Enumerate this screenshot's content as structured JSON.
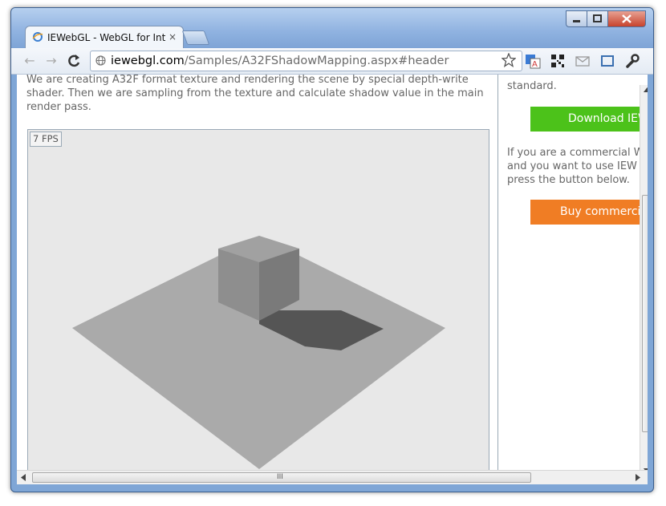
{
  "tab": {
    "title": "IEWebGL - WebGL for Interr",
    "close": "×"
  },
  "nav": {
    "back": "←",
    "forward": "→",
    "reload": "C"
  },
  "address": {
    "host": "iewebgl.com",
    "path": "/Samples/A32FShadowMapping.aspx#header"
  },
  "toolbar_icons": [
    "star-icon",
    "translate-icon",
    "qr-code-icon",
    "mail-icon",
    "fullscreen-icon",
    "wrench-icon"
  ],
  "page": {
    "intro": "We are creating A32F format texture and rendering the scene by special depth-write shader. Then we are sampling from the texture and calculate shadow value in the main render pass.",
    "fps": "7 FPS"
  },
  "sidebar": {
    "top_text": "standard.",
    "download_button": "Download IEWebGL",
    "commercial_lines": [
      "If you are a commercial W",
      "and you want to use IEW",
      "press the button below."
    ],
    "buy_button": "Buy commercial"
  },
  "scrollbar": {
    "grip": "III"
  },
  "colors": {
    "download_green": "#4cc21a",
    "buy_orange": "#f07d24",
    "scene_background": "#e8e8e8",
    "floor": "#aaaaaa",
    "shadow": "#555555"
  }
}
